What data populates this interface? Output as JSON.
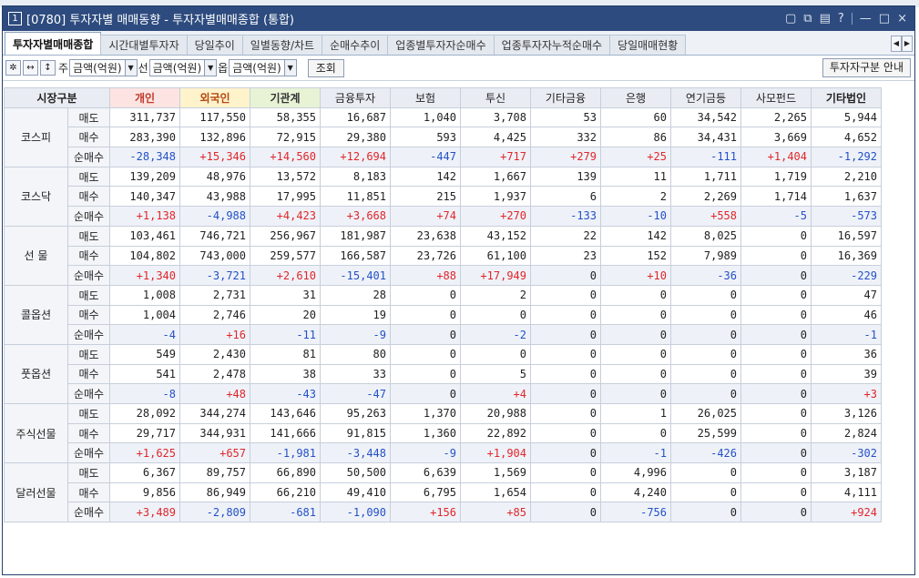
{
  "window": {
    "number": "1",
    "title": "[0780] 투자자별 매매동향 - 투자자별매매종합 (통합)",
    "title_buttons": [
      "▢",
      "⧉",
      "▤",
      "?",
      "—",
      "□",
      "×"
    ]
  },
  "tabs": [
    "투자자별매매종합",
    "시간대별투자자",
    "당일추이",
    "일별동향/차트",
    "순매수추이",
    "업종별투자자순매수",
    "업종투자자누적순매수",
    "당일매매현황"
  ],
  "tab_scroll": [
    "◀",
    "▶"
  ],
  "toolbar": {
    "gear": "✲",
    "expand": "↔",
    "updown": "↕",
    "label1": "주",
    "select1": "금액(억원)",
    "label2": "선",
    "select2": "금액(억원)",
    "label3": "옵",
    "select3": "금액(억원)",
    "arrow": "▼",
    "query_button": "조회",
    "guide_button": "투자자구분 안내"
  },
  "table": {
    "headers": [
      "시장구분",
      "개인",
      "외국인",
      "기관계",
      "금융투자",
      "보험",
      "투신",
      "기타금융",
      "은행",
      "연기금등",
      "사모펀드",
      "기타법인"
    ],
    "row_labels": [
      "매도",
      "매수",
      "순매수"
    ],
    "markets": [
      {
        "name": "코스피",
        "rows": [
          [
            "311,737",
            "117,550",
            "58,355",
            "16,687",
            "1,040",
            "3,708",
            "53",
            "60",
            "34,542",
            "2,265",
            "5,944"
          ],
          [
            "283,390",
            "132,896",
            "72,915",
            "29,380",
            "593",
            "4,425",
            "332",
            "86",
            "34,431",
            "3,669",
            "4,652"
          ],
          [
            "-28,348",
            "+15,346",
            "+14,560",
            "+12,694",
            "-447",
            "+717",
            "+279",
            "+25",
            "-111",
            "+1,404",
            "-1,292"
          ]
        ]
      },
      {
        "name": "코스닥",
        "rows": [
          [
            "139,209",
            "48,976",
            "13,572",
            "8,183",
            "142",
            "1,667",
            "139",
            "11",
            "1,711",
            "1,719",
            "2,210"
          ],
          [
            "140,347",
            "43,988",
            "17,995",
            "11,851",
            "215",
            "1,937",
            "6",
            "2",
            "2,269",
            "1,714",
            "1,637"
          ],
          [
            "+1,138",
            "-4,988",
            "+4,423",
            "+3,668",
            "+74",
            "+270",
            "-133",
            "-10",
            "+558",
            "-5",
            "-573"
          ]
        ]
      },
      {
        "name": "선  물",
        "rows": [
          [
            "103,461",
            "746,721",
            "256,967",
            "181,987",
            "23,638",
            "43,152",
            "22",
            "142",
            "8,025",
            "0",
            "16,597"
          ],
          [
            "104,802",
            "743,000",
            "259,577",
            "166,587",
            "23,726",
            "61,100",
            "23",
            "152",
            "7,989",
            "0",
            "16,369"
          ],
          [
            "+1,340",
            "-3,721",
            "+2,610",
            "-15,401",
            "+88",
            "+17,949",
            "0",
            "+10",
            "-36",
            "0",
            "-229"
          ]
        ]
      },
      {
        "name": "콜옵션",
        "rows": [
          [
            "1,008",
            "2,731",
            "31",
            "28",
            "0",
            "2",
            "0",
            "0",
            "0",
            "0",
            "47"
          ],
          [
            "1,004",
            "2,746",
            "20",
            "19",
            "0",
            "0",
            "0",
            "0",
            "0",
            "0",
            "46"
          ],
          [
            "-4",
            "+16",
            "-11",
            "-9",
            "0",
            "-2",
            "0",
            "0",
            "0",
            "0",
            "-1"
          ]
        ]
      },
      {
        "name": "풋옵션",
        "rows": [
          [
            "549",
            "2,430",
            "81",
            "80",
            "0",
            "0",
            "0",
            "0",
            "0",
            "0",
            "36"
          ],
          [
            "541",
            "2,478",
            "38",
            "33",
            "0",
            "5",
            "0",
            "0",
            "0",
            "0",
            "39"
          ],
          [
            "-8",
            "+48",
            "-43",
            "-47",
            "0",
            "+4",
            "0",
            "0",
            "0",
            "0",
            "+3"
          ]
        ]
      },
      {
        "name": "주식선물",
        "rows": [
          [
            "28,092",
            "344,274",
            "143,646",
            "95,263",
            "1,370",
            "20,988",
            "0",
            "1",
            "26,025",
            "0",
            "3,126"
          ],
          [
            "29,717",
            "344,931",
            "141,666",
            "91,815",
            "1,360",
            "22,892",
            "0",
            "0",
            "25,599",
            "0",
            "2,824"
          ],
          [
            "+1,625",
            "+657",
            "-1,981",
            "-3,448",
            "-9",
            "+1,904",
            "0",
            "-1",
            "-426",
            "0",
            "-302"
          ]
        ]
      },
      {
        "name": "달러선물",
        "rows": [
          [
            "6,367",
            "89,757",
            "66,890",
            "50,500",
            "6,639",
            "1,569",
            "0",
            "4,996",
            "0",
            "0",
            "3,187"
          ],
          [
            "9,856",
            "86,949",
            "66,210",
            "49,410",
            "6,795",
            "1,654",
            "0",
            "4,240",
            "0",
            "0",
            "4,111"
          ],
          [
            "+3,489",
            "-2,809",
            "-681",
            "-1,090",
            "+156",
            "+85",
            "0",
            "-756",
            "0",
            "0",
            "+924"
          ]
        ]
      }
    ]
  },
  "colors": {
    "titlebar": "#2d4b7e",
    "positive": "#e0262b",
    "negative": "#2450c8"
  }
}
